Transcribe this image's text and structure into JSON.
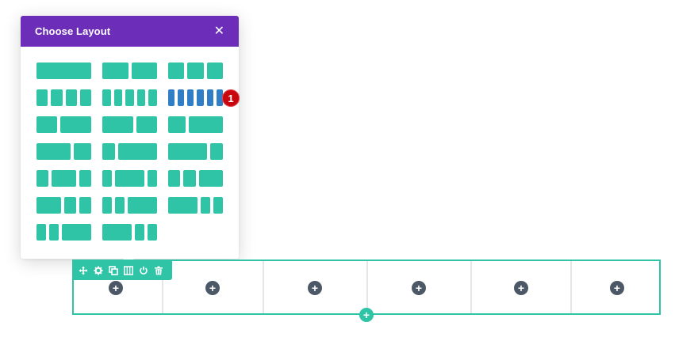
{
  "modal": {
    "title": "Choose Layout",
    "close_icon": "close-icon"
  },
  "layouts": [
    {
      "id": "layout-1",
      "columns": [
        1
      ]
    },
    {
      "id": "layout-1-2-1-2",
      "columns": [
        1,
        1
      ]
    },
    {
      "id": "layout-1-3x3",
      "columns": [
        1,
        1,
        1
      ]
    },
    {
      "id": "layout-1-4x4",
      "columns": [
        1,
        1,
        1,
        1
      ]
    },
    {
      "id": "layout-1-5x5",
      "columns": [
        1,
        1,
        1,
        1,
        1
      ]
    },
    {
      "id": "layout-1-6x6",
      "columns": [
        1,
        1,
        1,
        1,
        1,
        1
      ],
      "selected": true
    },
    {
      "id": "layout-2-5-3-5",
      "columns": [
        2,
        3
      ]
    },
    {
      "id": "layout-3-5-2-5",
      "columns": [
        3,
        2
      ]
    },
    {
      "id": "layout-1-3-2-3",
      "columns": [
        1,
        2
      ]
    },
    {
      "id": "layout-2-3-1-3",
      "columns": [
        2,
        1
      ]
    },
    {
      "id": "layout-1-4-3-4",
      "columns": [
        1,
        3
      ]
    },
    {
      "id": "layout-3-4-1-4",
      "columns": [
        3,
        1
      ]
    },
    {
      "id": "layout-1-4-1-2-1-4",
      "columns": [
        1,
        2,
        1
      ]
    },
    {
      "id": "layout-1-5-3-5-1-5",
      "columns": [
        1,
        3,
        1
      ]
    },
    {
      "id": "layout-1-4-1-4-1-2",
      "columns": [
        1,
        1,
        2
      ]
    },
    {
      "id": "layout-1-2-1-4-1-4",
      "columns": [
        2,
        1,
        1
      ]
    },
    {
      "id": "layout-1-5-1-5-3-5",
      "columns": [
        1,
        1,
        3
      ]
    },
    {
      "id": "layout-3-5-1-5-1-5",
      "columns": [
        3,
        1,
        1
      ]
    },
    {
      "id": "layout-1-6-1-6-1-2",
      "columns": [
        1,
        1,
        3
      ]
    },
    {
      "id": "layout-1-2-1-6-1-6",
      "columns": [
        3,
        1,
        1
      ]
    }
  ],
  "badge": {
    "label": "1"
  },
  "row": {
    "column_count": 6,
    "add_module_label": "+",
    "add_row_label": "+",
    "toolbar_icons": [
      "move-icon",
      "gear-icon",
      "duplicate-icon",
      "columns-icon",
      "power-icon",
      "trash-icon"
    ]
  },
  "colors": {
    "accent": "#30c4a7",
    "header": "#6c2eb9",
    "selected": "#2f7ec6",
    "badge": "#c8060e",
    "add_button": "#4c5866"
  }
}
